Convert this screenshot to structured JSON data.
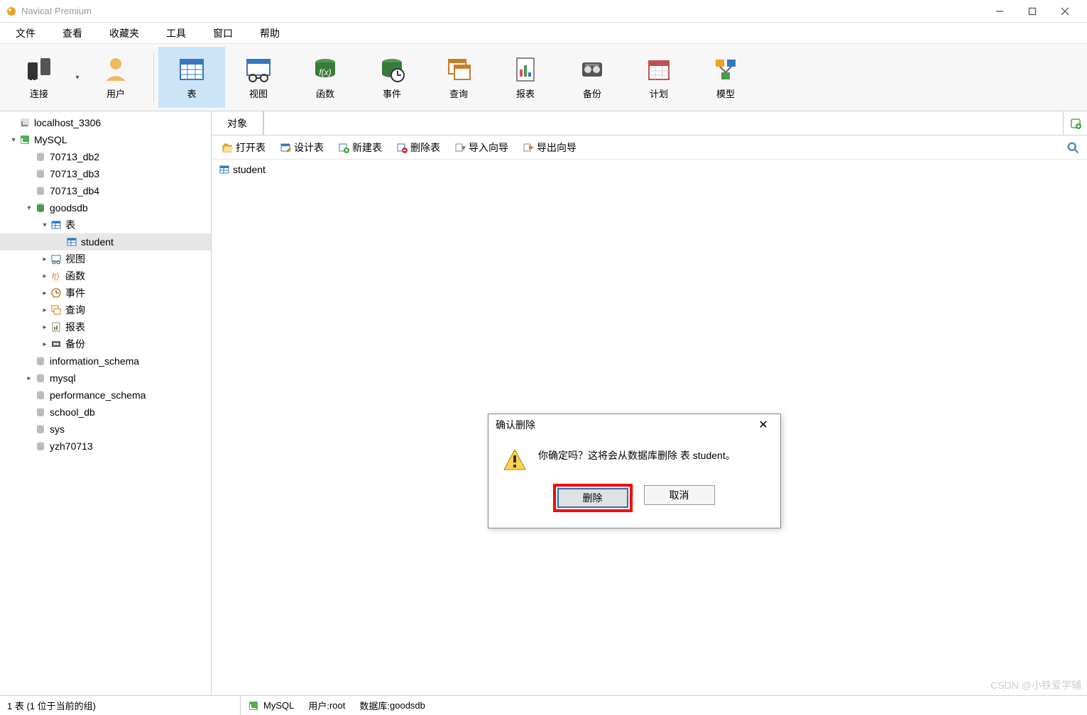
{
  "app": {
    "title": "Navicat Premium"
  },
  "menubar": [
    "文件",
    "查看",
    "收藏夹",
    "工具",
    "窗口",
    "帮助"
  ],
  "toolbar": [
    {
      "label": "连接",
      "icon": "plug",
      "dropdown": true
    },
    {
      "label": "用户",
      "icon": "user"
    },
    {
      "sep": true
    },
    {
      "label": "表",
      "icon": "table",
      "active": true
    },
    {
      "label": "视图",
      "icon": "view"
    },
    {
      "label": "函数",
      "icon": "func"
    },
    {
      "label": "事件",
      "icon": "event"
    },
    {
      "label": "查询",
      "icon": "query"
    },
    {
      "label": "报表",
      "icon": "report"
    },
    {
      "label": "备份",
      "icon": "backup"
    },
    {
      "label": "计划",
      "icon": "schedule"
    },
    {
      "label": "模型",
      "icon": "model"
    }
  ],
  "tree": [
    {
      "depth": 0,
      "icon": "conn-off",
      "caret": "",
      "label": "localhost_3306"
    },
    {
      "depth": 0,
      "icon": "conn-on",
      "caret": "v",
      "label": "MySQL"
    },
    {
      "depth": 1,
      "icon": "db",
      "caret": "",
      "label": "70713_db2"
    },
    {
      "depth": 1,
      "icon": "db",
      "caret": "",
      "label": "70713_db3"
    },
    {
      "depth": 1,
      "icon": "db",
      "caret": "",
      "label": "70713_db4"
    },
    {
      "depth": 1,
      "icon": "db-on",
      "caret": "v",
      "label": "goodsdb"
    },
    {
      "depth": 2,
      "icon": "tables",
      "caret": "v",
      "label": "表"
    },
    {
      "depth": 3,
      "icon": "table",
      "caret": "",
      "label": "student",
      "selected": true
    },
    {
      "depth": 2,
      "icon": "view",
      "caret": ">",
      "label": "视图"
    },
    {
      "depth": 2,
      "icon": "func",
      "caret": ">",
      "label": "函数"
    },
    {
      "depth": 2,
      "icon": "event",
      "caret": ">",
      "label": "事件"
    },
    {
      "depth": 2,
      "icon": "query",
      "caret": ">",
      "label": "查询"
    },
    {
      "depth": 2,
      "icon": "report",
      "caret": ">",
      "label": "报表"
    },
    {
      "depth": 2,
      "icon": "backup",
      "caret": ">",
      "label": "备份"
    },
    {
      "depth": 1,
      "icon": "db",
      "caret": "",
      "label": "information_schema"
    },
    {
      "depth": 1,
      "icon": "db",
      "caret": ">",
      "label": "mysql"
    },
    {
      "depth": 1,
      "icon": "db",
      "caret": "",
      "label": "performance_schema"
    },
    {
      "depth": 1,
      "icon": "db",
      "caret": "",
      "label": "school_db"
    },
    {
      "depth": 1,
      "icon": "db",
      "caret": "",
      "label": "sys"
    },
    {
      "depth": 1,
      "icon": "db",
      "caret": "",
      "label": "yzh70713"
    }
  ],
  "content_tab": "对象",
  "sub_toolbar": [
    {
      "label": "打开表",
      "icon": "open"
    },
    {
      "label": "设计表",
      "icon": "design"
    },
    {
      "label": "新建表",
      "icon": "new"
    },
    {
      "label": "删除表",
      "icon": "delete"
    },
    {
      "label": "导入向导",
      "icon": "import"
    },
    {
      "label": "导出向导",
      "icon": "export"
    }
  ],
  "objects": [
    {
      "label": "student",
      "icon": "table"
    }
  ],
  "dialog": {
    "title": "确认删除",
    "message": "你确定吗？这将会从数据库删除 表 student。",
    "confirm": "删除",
    "cancel": "取消"
  },
  "statusbar": {
    "left": "1 表 (1 位于当前的组)",
    "conn": "MySQL",
    "user_label": "用户: ",
    "user": "root",
    "db_label": "数据库: ",
    "db": "goodsdb"
  },
  "watermark": "CSDN @小铁爱学辅"
}
